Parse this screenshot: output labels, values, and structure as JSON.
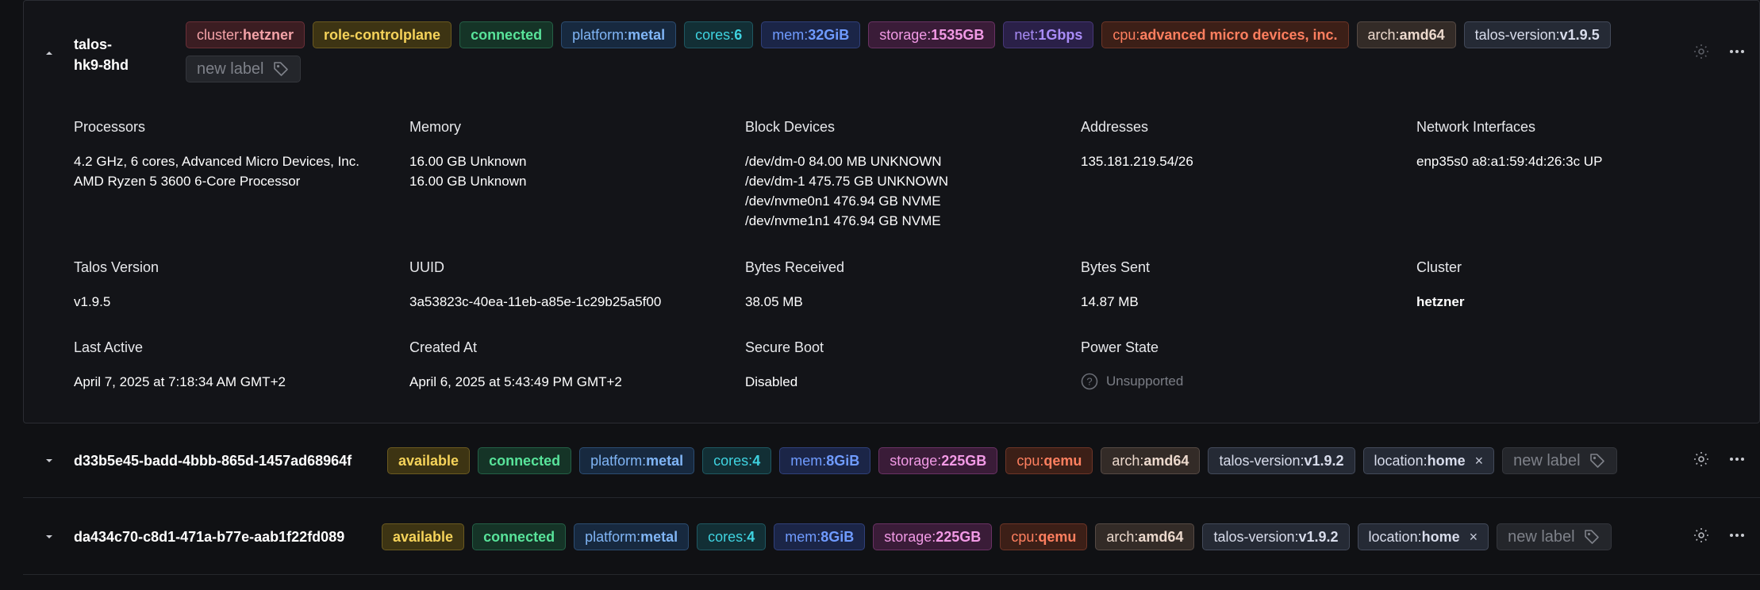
{
  "machines": [
    {
      "name_lines": [
        "talos-",
        "hk9-8hd"
      ],
      "expanded": true,
      "labels": [
        {
          "key": "cluster:",
          "value": "hetzner",
          "color": "red",
          "removable": false
        },
        {
          "key": "",
          "value": "role-controlplane",
          "color": "yellow",
          "removable": false
        },
        {
          "key": "",
          "value": "connected",
          "color": "green",
          "removable": false
        },
        {
          "key": "platform:",
          "value": "metal",
          "color": "blue",
          "removable": false
        },
        {
          "key": "cores:",
          "value": "6",
          "color": "cyan",
          "removable": false
        },
        {
          "key": "mem:",
          "value": "32GiB",
          "color": "indigo",
          "removable": false
        },
        {
          "key": "storage:",
          "value": "1535GB",
          "color": "pink",
          "removable": false
        },
        {
          "key": "net:",
          "value": "1Gbps",
          "color": "violet",
          "removable": false
        },
        {
          "key": "cpu:",
          "value": "advanced micro devices, inc.",
          "color": "orange",
          "removable": false
        },
        {
          "key": "arch:",
          "value": "amd64",
          "color": "stone",
          "removable": false
        },
        {
          "key": "talos-version:",
          "value": "v1.9.5",
          "color": "slate",
          "removable": false
        }
      ],
      "new_label_text": "new label",
      "details": {
        "processors_heading": "Processors",
        "processors_lines": [
          "4.2 GHz, 6 cores, Advanced Micro Devices, Inc.",
          "AMD Ryzen 5 3600 6-Core Processor"
        ],
        "memory_heading": "Memory",
        "memory_lines": [
          "16.00 GB Unknown",
          "16.00 GB Unknown"
        ],
        "block_devices_heading": "Block Devices",
        "block_devices_lines": [
          "/dev/dm-0 84.00 MB UNKNOWN",
          "/dev/dm-1 475.75 GB UNKNOWN",
          "/dev/nvme0n1 476.94 GB NVME",
          "/dev/nvme1n1 476.94 GB NVME"
        ],
        "addresses_heading": "Addresses",
        "addresses_lines": [
          "135.181.219.54/26"
        ],
        "network_heading": "Network Interfaces",
        "network_lines": [
          "enp35s0 a8:a1:59:4d:26:3c UP"
        ],
        "talos_version_heading": "Talos Version",
        "talos_version": "v1.9.5",
        "uuid_heading": "UUID",
        "uuid": "3a53823c-40ea-11eb-a85e-1c29b25a5f00",
        "bytes_received_heading": "Bytes Received",
        "bytes_received": "38.05 MB",
        "bytes_sent_heading": "Bytes Sent",
        "bytes_sent": "14.87 MB",
        "cluster_heading": "Cluster",
        "cluster": "hetzner",
        "last_active_heading": "Last Active",
        "last_active": "April 7, 2025 at 7:18:34 AM GMT+2",
        "created_at_heading": "Created At",
        "created_at": "April 6, 2025 at 5:43:49 PM GMT+2",
        "secure_boot_heading": "Secure Boot",
        "secure_boot": "Disabled",
        "power_state_heading": "Power State",
        "power_state": "Unsupported"
      }
    },
    {
      "name": "d33b5e45-badd-4bbb-865d-1457ad68964f",
      "expanded": false,
      "labels": [
        {
          "key": "",
          "value": "available",
          "color": "yellow",
          "removable": false
        },
        {
          "key": "",
          "value": "connected",
          "color": "green",
          "removable": false
        },
        {
          "key": "platform:",
          "value": "metal",
          "color": "blue",
          "removable": false
        },
        {
          "key": "cores:",
          "value": "4",
          "color": "cyan",
          "removable": false
        },
        {
          "key": "mem:",
          "value": "8GiB",
          "color": "indigo",
          "removable": false
        },
        {
          "key": "storage:",
          "value": "225GB",
          "color": "pink",
          "removable": false
        },
        {
          "key": "cpu:",
          "value": "qemu",
          "color": "orange",
          "removable": false
        },
        {
          "key": "arch:",
          "value": "amd64",
          "color": "stone",
          "removable": false
        },
        {
          "key": "talos-version:",
          "value": "v1.9.2",
          "color": "slate",
          "removable": false
        },
        {
          "key": "location:",
          "value": "home",
          "color": "slate",
          "removable": true
        }
      ],
      "new_label_text": "new label"
    },
    {
      "name": "da434c70-c8d1-471a-b77e-aab1f22fd089",
      "expanded": false,
      "labels": [
        {
          "key": "",
          "value": "available",
          "color": "yellow",
          "removable": false
        },
        {
          "key": "",
          "value": "connected",
          "color": "green",
          "removable": false
        },
        {
          "key": "platform:",
          "value": "metal",
          "color": "blue",
          "removable": false
        },
        {
          "key": "cores:",
          "value": "4",
          "color": "cyan",
          "removable": false
        },
        {
          "key": "mem:",
          "value": "8GiB",
          "color": "indigo",
          "removable": false
        },
        {
          "key": "storage:",
          "value": "225GB",
          "color": "pink",
          "removable": false
        },
        {
          "key": "cpu:",
          "value": "qemu",
          "color": "orange",
          "removable": false
        },
        {
          "key": "arch:",
          "value": "amd64",
          "color": "stone",
          "removable": false
        },
        {
          "key": "talos-version:",
          "value": "v1.9.2",
          "color": "slate",
          "removable": false
        },
        {
          "key": "location:",
          "value": "home",
          "color": "slate",
          "removable": true
        }
      ],
      "new_label_text": "new label"
    }
  ],
  "icons": {
    "expand": "chevron-down-icon",
    "collapse": "chevron-up-icon",
    "settings": "gear-settings-icon",
    "more": "more-horizontal-icon",
    "tag": "tag-icon",
    "remove": "close-icon",
    "help": "question-circle-icon"
  },
  "remove_glyph": "×"
}
